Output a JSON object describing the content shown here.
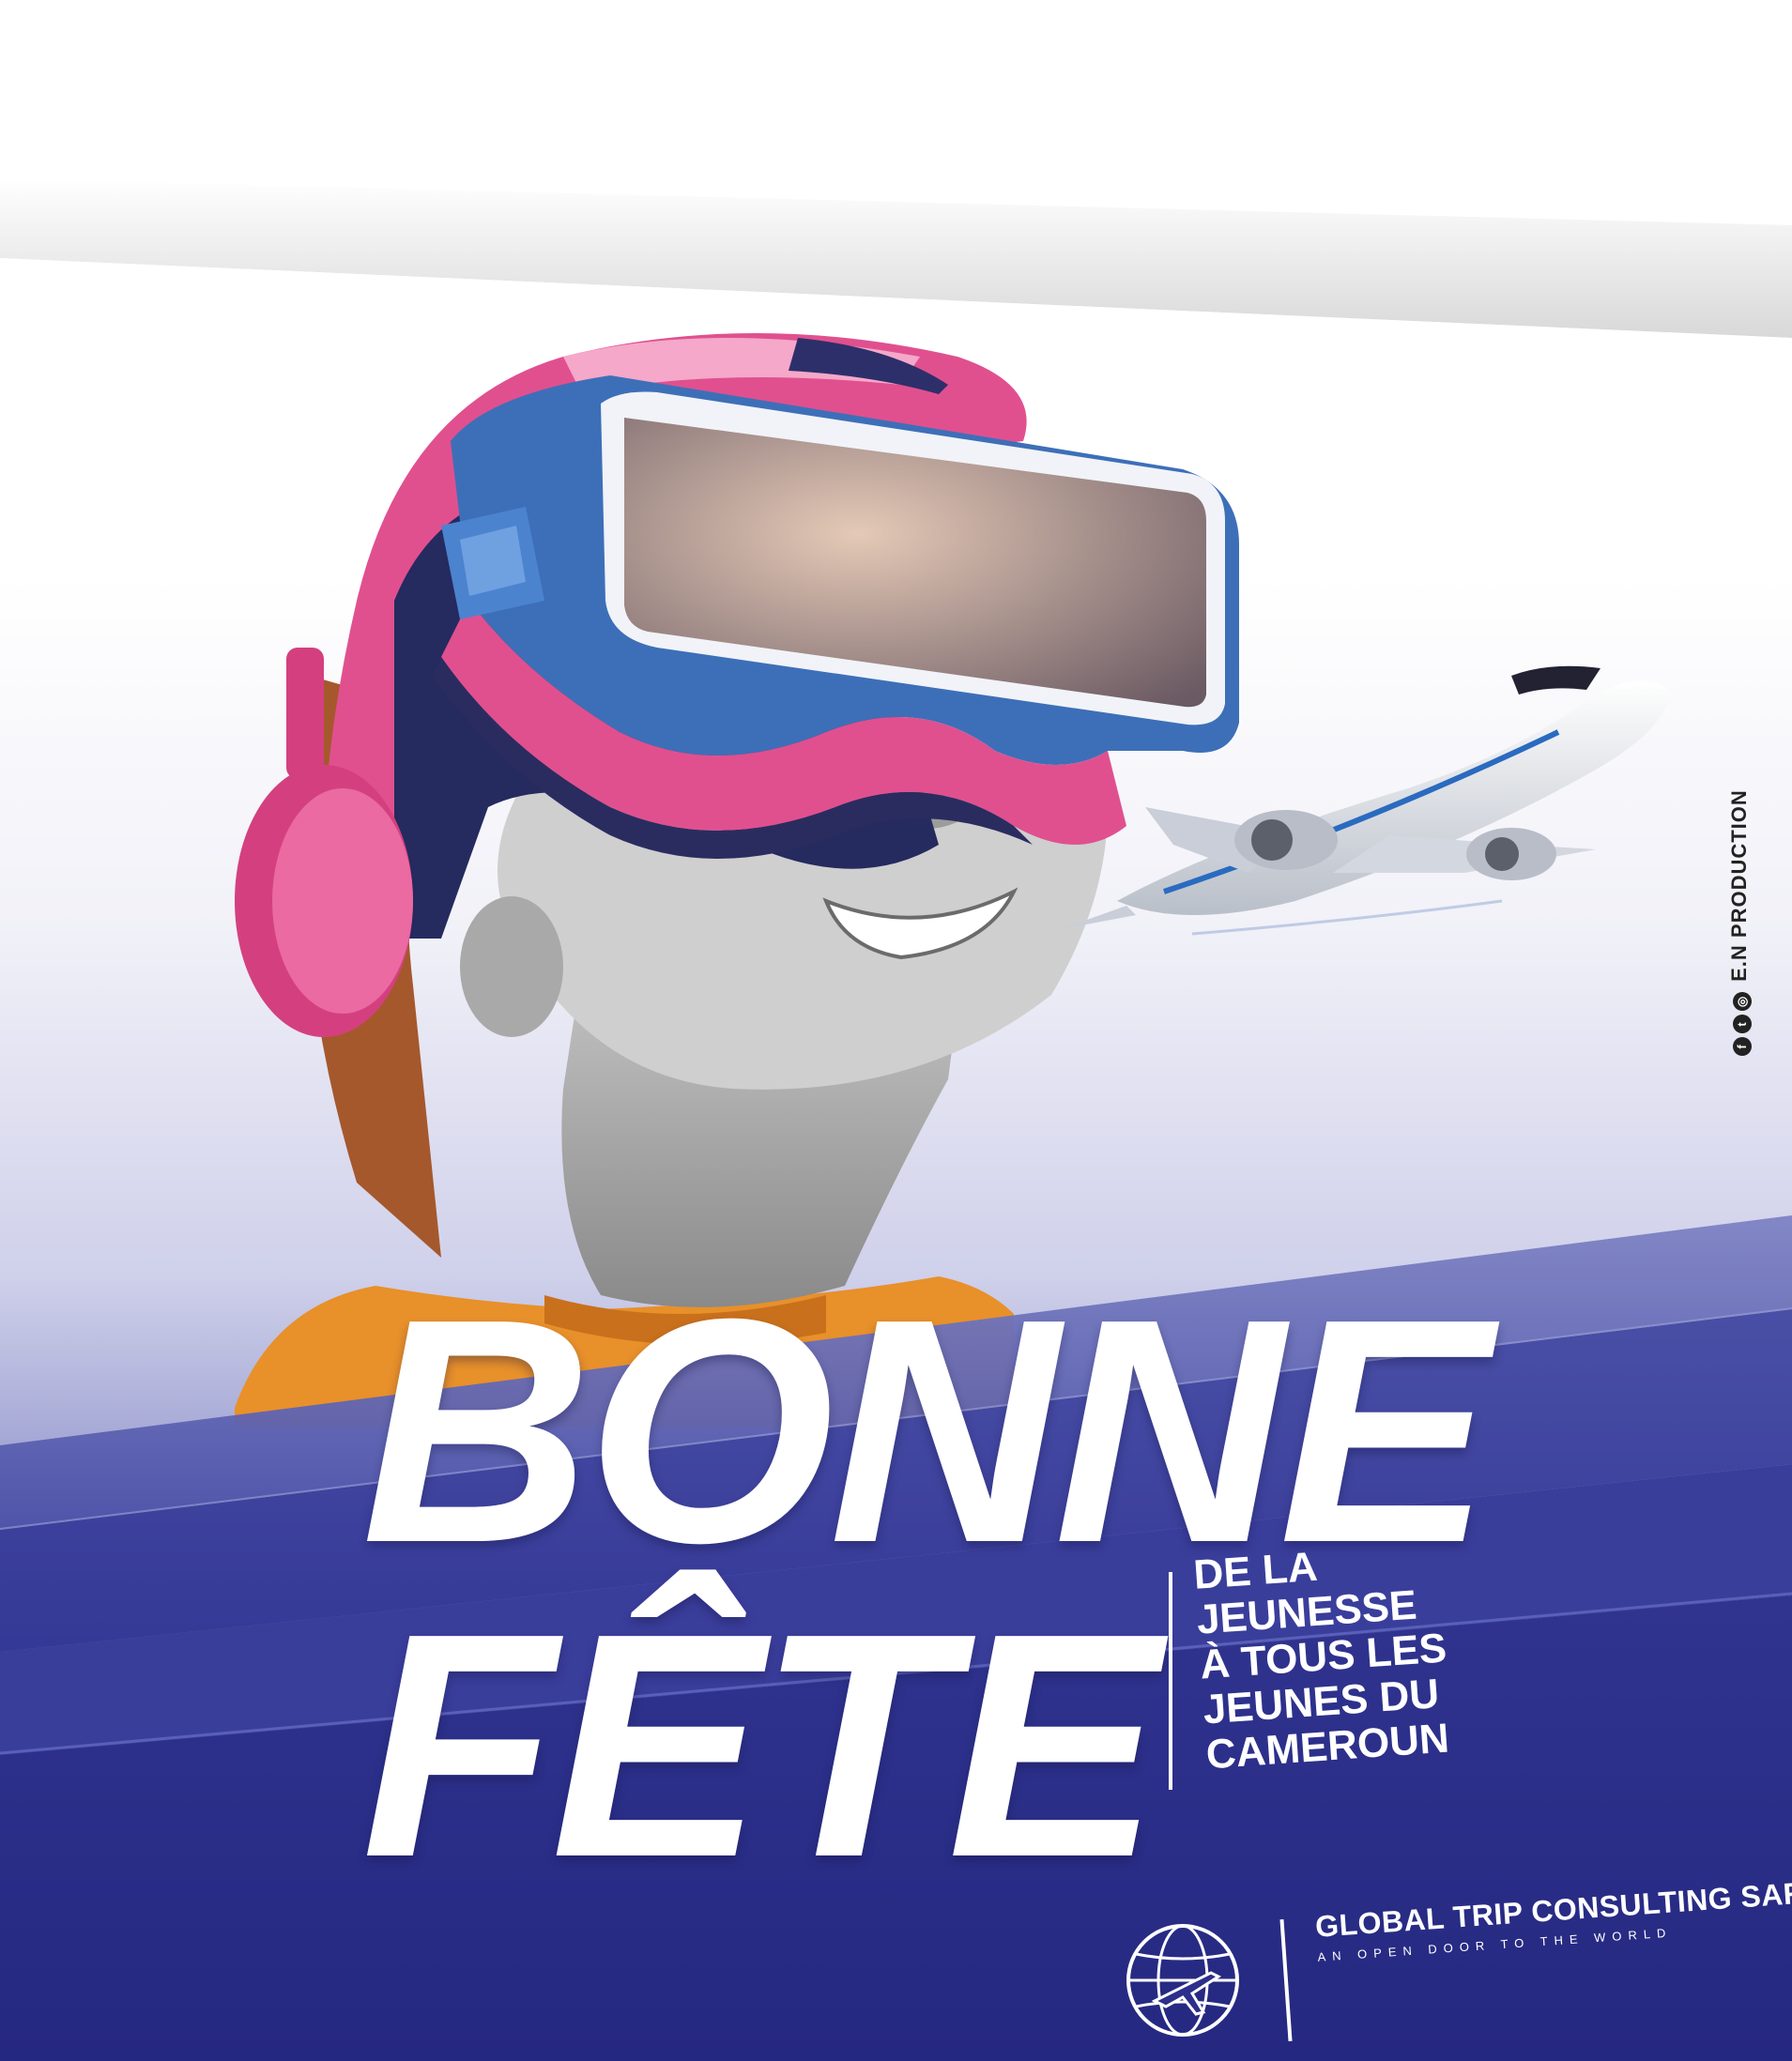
{
  "headline": {
    "line1": "BONNE",
    "line2": "FÊTE"
  },
  "tagline": [
    "DE LA",
    "JEUNESSE",
    "À TOUS LES",
    "JEUNES DU",
    "CAMEROUN"
  ],
  "credit": {
    "text": "E.N PRODUCTION",
    "icons": [
      "facebook-icon",
      "twitter-icon",
      "instagram-icon"
    ]
  },
  "company": {
    "name": "GLOBAL TRIP CONSULTING SARL",
    "slogan": "AN OPEN DOOR TO THE WORLD"
  },
  "colors": {
    "brand_blue": "#2c2f8c",
    "mid_blue": "#4a4fa6",
    "headset_pink": "#e0508f",
    "shirt_orange": "#e8902a"
  }
}
